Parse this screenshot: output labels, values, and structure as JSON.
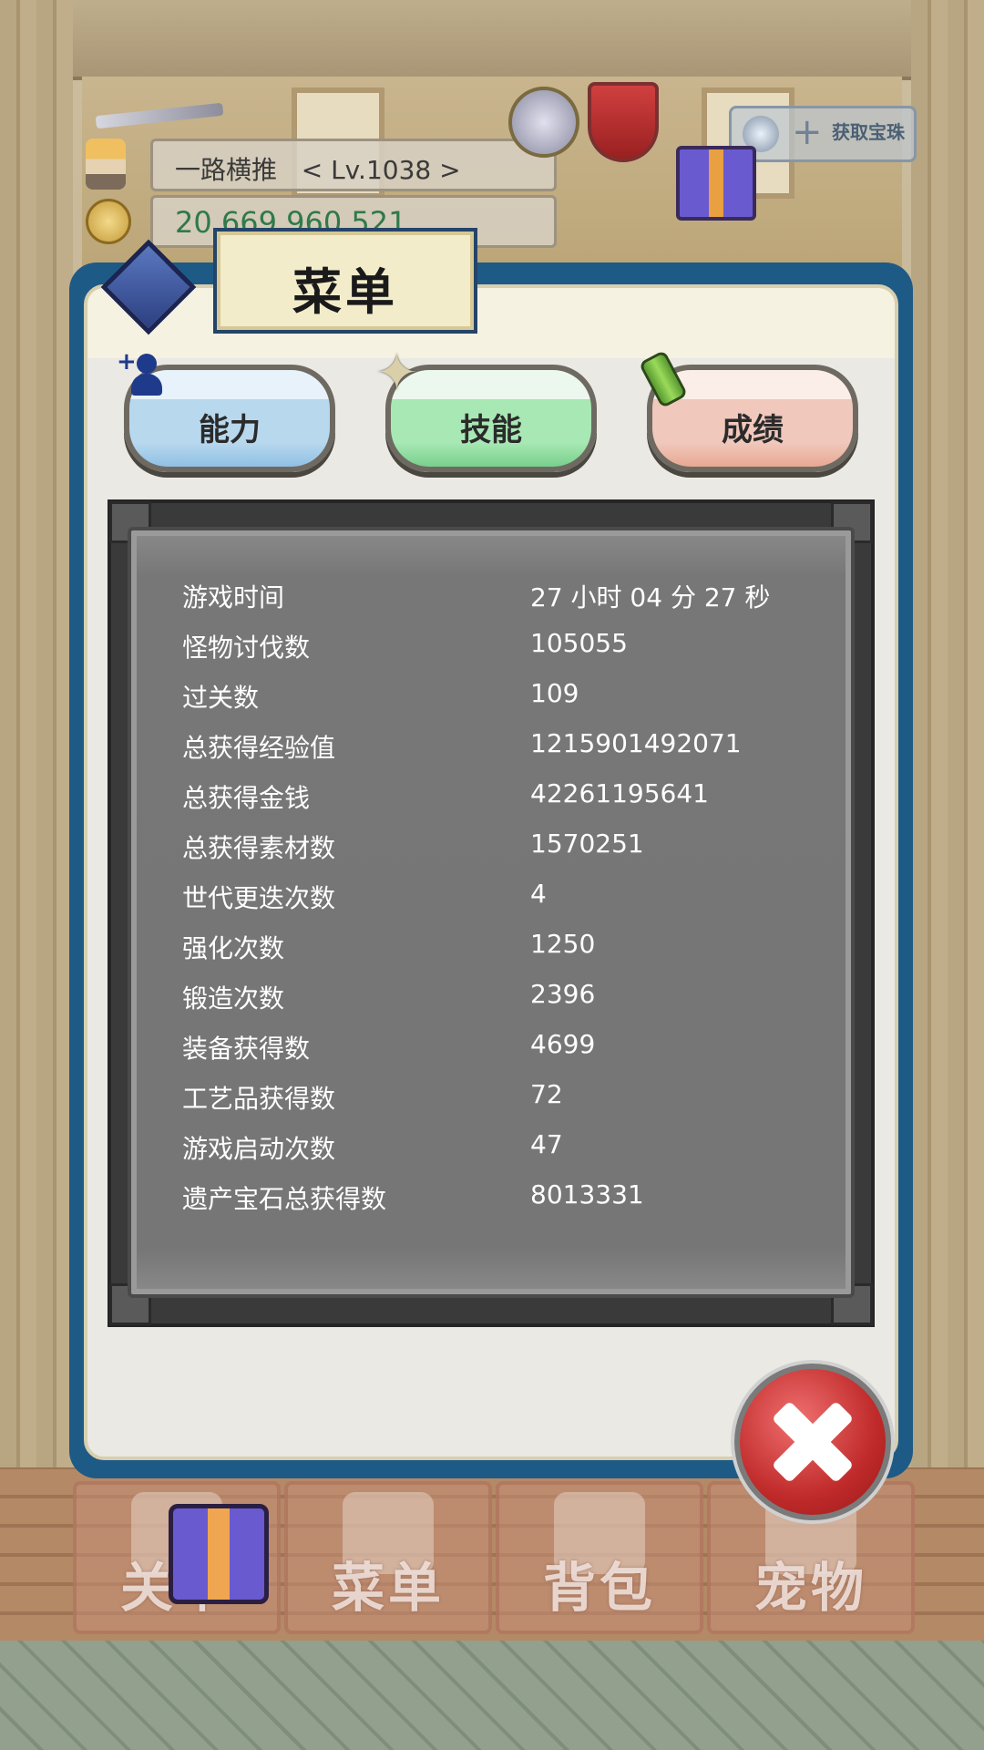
{
  "hud": {
    "player_name_level": "一路横推   < Lv.1038 >",
    "gold": "20,669,960,521",
    "gem_button_label": "获取宝珠"
  },
  "dialog": {
    "title": "菜单",
    "tabs": [
      "能力",
      "技能",
      "成绩"
    ]
  },
  "stats": [
    {
      "label": "游戏时间",
      "value": "27 小时 04 分 27 秒"
    },
    {
      "label": "怪物讨伐数",
      "value": "105055"
    },
    {
      "label": "过关数",
      "value": "109"
    },
    {
      "label": "总获得经验值",
      "value": "1215901492071"
    },
    {
      "label": "总获得金钱",
      "value": "42261195641"
    },
    {
      "label": "总获得素材数",
      "value": "1570251"
    },
    {
      "label": "世代更迭次数",
      "value": "4"
    },
    {
      "label": "强化次数",
      "value": "1250"
    },
    {
      "label": "锻造次数",
      "value": "2396"
    },
    {
      "label": "装备获得数",
      "value": "4699"
    },
    {
      "label": "工艺品获得数",
      "value": "72"
    },
    {
      "label": "游戏启动次数",
      "value": "47"
    },
    {
      "label": "遗产宝石总获得数",
      "value": "8013331"
    }
  ],
  "bottom_nav": [
    "关卡",
    "菜单",
    "背包",
    "宠物"
  ],
  "colors": {
    "dialog_border": "#1e5a86",
    "panel_gray": "#777777",
    "close_red": "#c02a2a"
  },
  "icons": [
    "hero-icon",
    "coin-icon",
    "sword-icon",
    "shield-icon",
    "gift-icon",
    "gem-icon",
    "book-icon",
    "user-plus-icon",
    "sparkle-icon",
    "scroll-icon",
    "close-icon"
  ]
}
